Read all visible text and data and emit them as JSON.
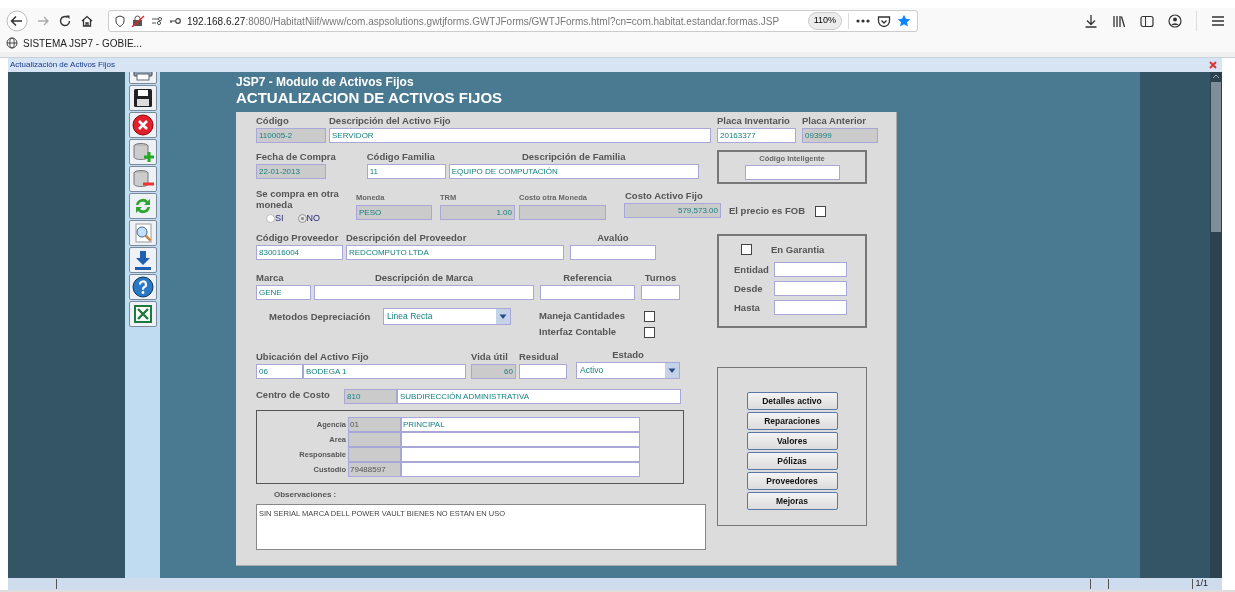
{
  "browser": {
    "url_host": "192.168.6.27",
    "url_rest": ":8080/HabitatNiif/www/com.aspsolutions.gwtjforms.GWTJForms/GWTJForms.html?cn=com.habitat.estandar.formas.JSP",
    "zoom": "110%",
    "bookmark": "SISTEMA JSP7 - GOBIE..."
  },
  "window": {
    "title": "Actualización de Activos Fijos"
  },
  "header": {
    "subtitle": "JSP7 - Modulo de Activos Fijos",
    "title": "ACTUALIZACION DE ACTIVOS FIJOS"
  },
  "fields": {
    "codigo": {
      "label": "Código",
      "value": "110005-2",
      "disabled": true
    },
    "descripcion": {
      "label": "Descripción del Activo Fijo",
      "value": "SERVIDOR",
      "disabled": false
    },
    "placa_inventario": {
      "label": "Placa Inventario",
      "value": "20163377",
      "disabled": false
    },
    "placa_anterior": {
      "label": "Placa Anterior",
      "value": "093999",
      "disabled": true
    },
    "fecha_compra": {
      "label": "Fecha de Compra",
      "value": "22-01-2013",
      "disabled": true
    },
    "codigo_familia": {
      "label": "Código Familia",
      "value": "11",
      "disabled": false
    },
    "descripcion_familia": {
      "label": "Descripción de Familia",
      "value": "EQUIPO DE COMPUTACIÓN",
      "disabled": false
    },
    "codigo_inteligente": {
      "label": "Código Inteligente",
      "disabled": false
    },
    "moneda": {
      "label": "Moneda",
      "value": "PESO",
      "disabled": true
    },
    "trm": {
      "label": "TRM",
      "value": "1.00",
      "disabled": true
    },
    "costo_otra_moneda": {
      "label": "Costo otra Moneda",
      "disabled": true
    },
    "costo_activo": {
      "label": "Costo Activo Fijo",
      "value": "579,573.00",
      "disabled": true
    },
    "codigo_proveedor": {
      "label": "Código Proveedor",
      "value": "830016004",
      "disabled": false
    },
    "descripcion_proveedor": {
      "label": "Descripción del Proveedor",
      "value": "REDCOMPUTO LTDA",
      "disabled": false
    },
    "avaluo": {
      "label": "Avalúo",
      "disabled": false
    },
    "marca": {
      "label": "Marca",
      "value": "GENE",
      "disabled": false
    },
    "descripcion_marca": {
      "label": "Descripción de Marca",
      "disabled": false
    },
    "referencia": {
      "label": "Referencia",
      "disabled": false
    },
    "turnos": {
      "label": "Turnos",
      "disabled": false
    },
    "entidad": {
      "label": "Entidad",
      "disabled": false
    },
    "desde": {
      "label": "Desde",
      "disabled": false
    },
    "hasta": {
      "label": "Hasta",
      "disabled": false
    },
    "ubicacion_codigo": {
      "label": "Ubicación del Activo Fijo",
      "value": "06",
      "disabled": false
    },
    "ubicacion_descripcion": {
      "value": "BODEGA 1",
      "disabled": false
    },
    "vida_util": {
      "label": "Vida útil",
      "value": "60",
      "disabled": true
    },
    "residual": {
      "label": "Residual",
      "disabled": false
    },
    "centro_costo_codigo": {
      "label": "Centro de Costo",
      "value": "810",
      "disabled": true
    },
    "centro_costo_descripcion": {
      "value": "SUBDIRECCIÓN ADMINISTRATIVA",
      "disabled": false
    },
    "observaciones": {
      "label": "Observaciones :",
      "value": "SIN SERIAL MARCA DELL POWER VAULT BIENES NO ESTAN EN USO"
    }
  },
  "otra_moneda": {
    "label": "Se compra en otra moneda",
    "options": [
      {
        "label": "SI",
        "selected": false
      },
      {
        "label": "NO",
        "selected": true
      }
    ]
  },
  "checkboxes": {
    "precio_fob": {
      "label": "El precio es FOB",
      "checked": false
    },
    "en_garantia": {
      "label": "En Garantia",
      "checked": false
    },
    "maneja_cantidades": {
      "label": "Maneja Cantidades",
      "checked": false
    },
    "interfaz_contable": {
      "label": "Interfaz Contable",
      "checked": false
    }
  },
  "selects": {
    "metodos": {
      "label": "Metodos Depreciación",
      "value": "Linea Recta"
    },
    "estado": {
      "label": "Estado",
      "value": "Activo"
    }
  },
  "responsables": [
    {
      "label": "Agencia",
      "code": "01",
      "name": "PRINCIPAL"
    },
    {
      "label": "Area"
    },
    {
      "label": "Responsable"
    },
    {
      "label": "Custodio",
      "code": "79488597"
    }
  ],
  "buttons": [
    "Detalles activo",
    "Reparaciones",
    "Valores",
    "Pólizas",
    "Proveedores",
    "Mejoras"
  ],
  "status_bar": {
    "page": "1/1"
  }
}
